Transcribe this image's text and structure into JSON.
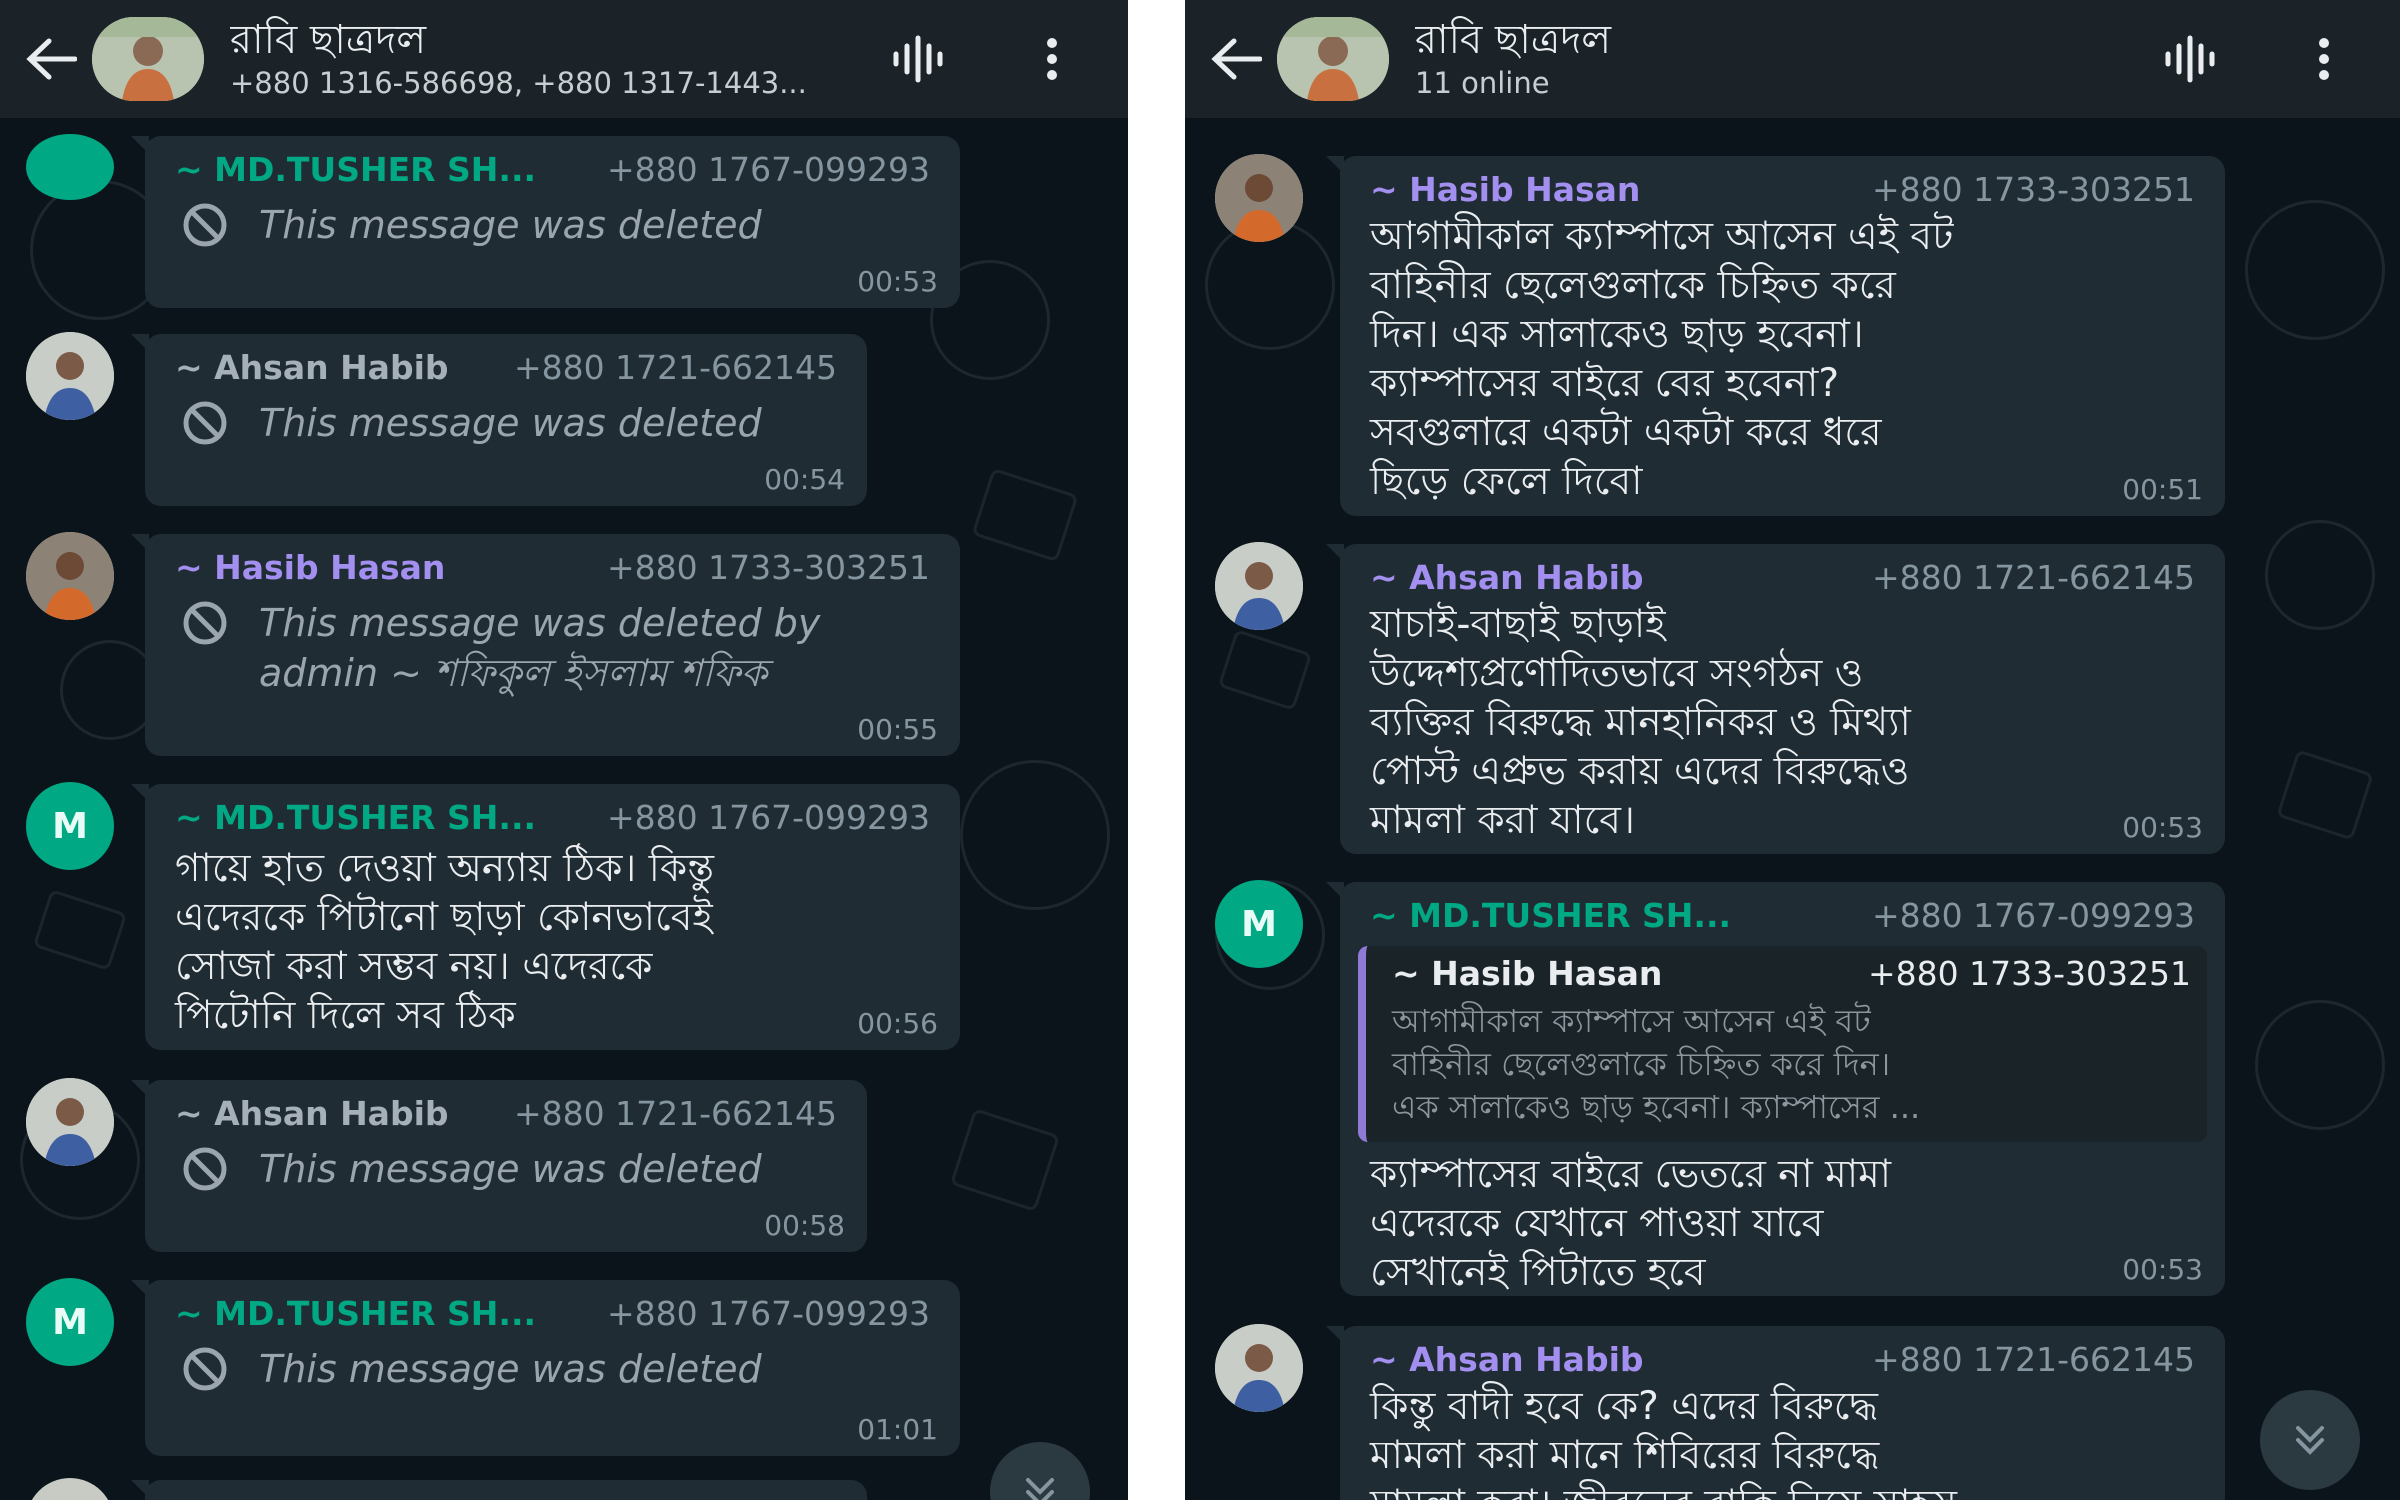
{
  "left": {
    "header": {
      "title": "রাবি ছাত্রদল",
      "subtitle": "+880 1316-586698, +880 1317-1443..."
    },
    "messages": [
      {
        "sender": "~ MD.TUSHER SH...",
        "phone": "+880 1767-099293",
        "deleted": "This message was deleted",
        "time": "00:53"
      },
      {
        "sender": "~ Ahsan Habib",
        "phone": "+880 1721-662145",
        "deleted": "This message was deleted",
        "time": "00:54"
      },
      {
        "sender": "~ Hasib Hasan",
        "phone": "+880 1733-303251",
        "deleted": "This message was deleted by admin ~ শফিকুল ইসলাম শফিক",
        "time": "00:55"
      },
      {
        "avatar_letter": "M",
        "sender": "~ MD.TUSHER SH...",
        "phone": "+880 1767-099293",
        "text": "গায়ে হাত দেওয়া অন্যায় ঠিক। কিন্তু\nএদেরকে পিটানো ছাড়া কোনভাবেই\nসোজা করা সম্ভব নয়। এদেরকে\nপিটোনি দিলে সব ঠিক",
        "time": "00:56"
      },
      {
        "sender": "~ Ahsan Habib",
        "phone": "+880 1721-662145",
        "deleted": "This message was deleted",
        "time": "00:58"
      },
      {
        "avatar_letter": "M",
        "sender": "~ MD.TUSHER SH...",
        "phone": "+880 1767-099293",
        "deleted": "This message was deleted",
        "time": "01:01"
      }
    ]
  },
  "right": {
    "header": {
      "title": "রাবি ছাত্রদল",
      "subtitle": "11 online"
    },
    "messages": [
      {
        "sender": "~ Hasib Hasan",
        "phone": "+880 1733-303251",
        "text": "আগামীকাল ক্যাম্পাসে আসেন এই বট\nবাহিনীর ছেলেগুলাকে চিহ্নিত করে\nদিন। এক সালাকেও ছাড় হবেনা।\nক্যাম্পাসের বাইরে বের হবেনা?\nসবগুলারে একটা একটা করে ধরে\nছিড়ে ফেলে দিবো",
        "time": "00:51"
      },
      {
        "sender": "~ Ahsan Habib",
        "phone": "+880 1721-662145",
        "text": "যাচাই-বাছাই ছাড়াই\nউদ্দেশ্যপ্রণোদিতভাবে সংগঠন ও\nব্যক্তির বিরুদ্ধে মানহানিকর ও মিথ্যা\nপোস্ট এপ্রুভ করায় এদের বিরুদ্ধেও\nমামলা করা যাবে।",
        "time": "00:53"
      },
      {
        "avatar_letter": "M",
        "sender": "~ MD.TUSHER SH...",
        "phone": "+880 1767-099293",
        "quote": {
          "sender": "~ Hasib Hasan",
          "phone": "+880 1733-303251",
          "text": "আগামীকাল ক্যাম্পাসে আসেন এই বট\nবাহিনীর ছেলেগুলাকে চিহ্নিত করে দিন।\nএক সালাকেও ছাড় হবেনা। ক্যাম্পাসের ..."
        },
        "text": "ক্যাম্পাসের বাইরে ভেতরে না মামা\nএদেরকে যেখানে পাওয়া যাবে\nসেখানেই পিটাতে হবে",
        "time": "00:53"
      },
      {
        "sender": "~ Ahsan Habib",
        "phone": "+880 1721-662145",
        "text": "কিন্তু বাদী হবে কে? এদের বিরুদ্ধে\nমামলা করা মানে শিবিরের বিরুদ্ধে\nমামলা করা। জীবনের বাকি নিয়ে সাহস"
      }
    ]
  },
  "colors": {
    "teal": "#00a884",
    "purple": "#a38ff0",
    "bubble": "#202c33",
    "header": "#1b2328",
    "background": "#0b141a"
  },
  "icons": [
    "back-arrow-icon",
    "voice-call-icon",
    "more-options-icon",
    "blocked-icon",
    "scroll-down-icon"
  ]
}
